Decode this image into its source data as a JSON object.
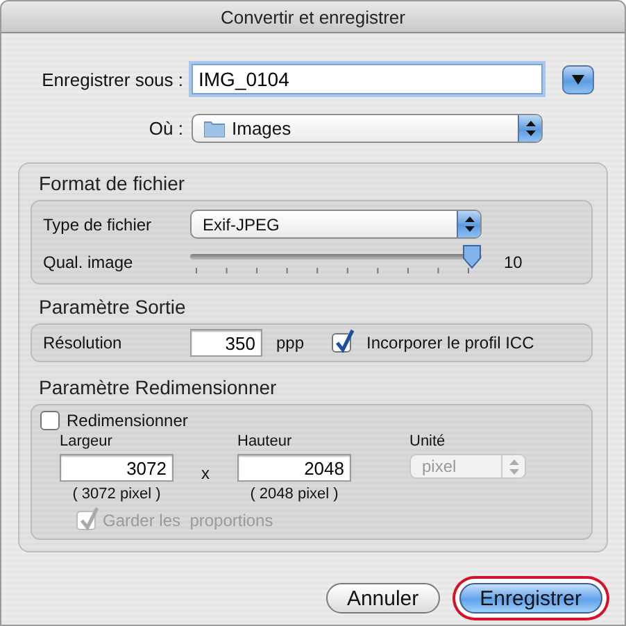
{
  "window": {
    "title": "Convertir et enregistrer"
  },
  "save_as": {
    "label": "Enregistrer sous :",
    "value": "IMG_0104"
  },
  "where": {
    "label": "Où :",
    "value": "Images"
  },
  "file_format": {
    "title": "Format de fichier",
    "type_label": "Type de fichier",
    "type_value": "Exif-JPEG",
    "quality_label": "Qual. image",
    "quality": {
      "level": 1.0,
      "reading": "10"
    }
  },
  "output": {
    "title": "Paramètre Sortie",
    "resolution_label": "Résolution",
    "resolution_value": "350",
    "unit": "ppp",
    "embed_icc": {
      "label": "Incorporer le profil ICC",
      "checked": true
    }
  },
  "resize": {
    "title": "Paramètre Redimensionner",
    "enable": {
      "label": "Redimensionner",
      "checked": false
    },
    "width": {
      "label": "Largeur",
      "value": "3072",
      "pixels": "( 3072 pixel )"
    },
    "times": "x",
    "height": {
      "label": "Hauteur",
      "value": "2048",
      "pixels": "( 2048 pixel )"
    },
    "unit": {
      "label": "Unité",
      "value": "pixel",
      "disabled": true
    },
    "keep_ratio": {
      "label": "Garder les  proportions",
      "checked": true,
      "disabled": true
    }
  },
  "buttons": [
    {
      "label": "Annuler",
      "default": false,
      "highlighted": false
    },
    {
      "label": "Enregistrer",
      "default": true,
      "highlighted": true
    }
  ]
}
